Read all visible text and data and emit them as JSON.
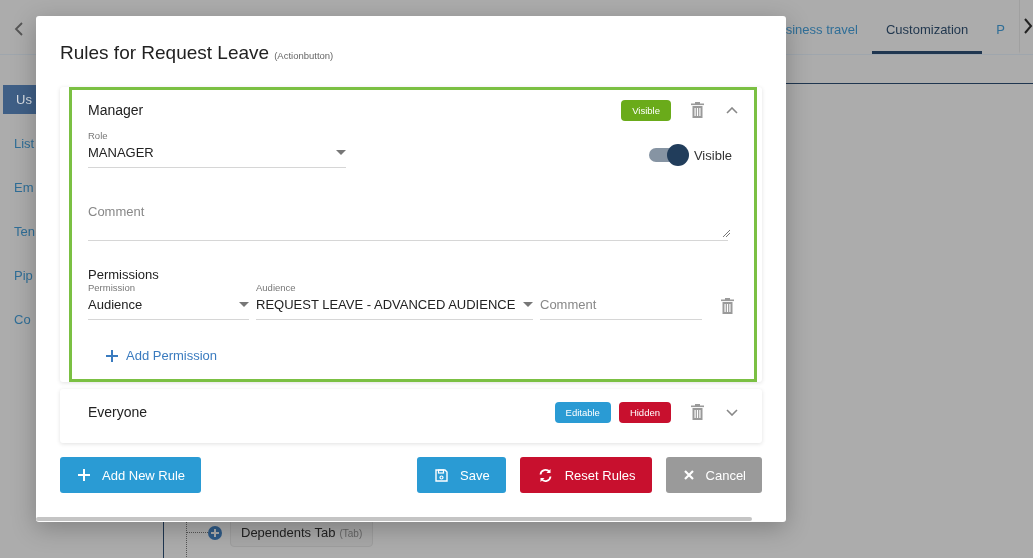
{
  "background_page": {
    "tabs": [
      {
        "label": "siness travel",
        "selected": false
      },
      {
        "label": "Customization",
        "selected": true
      },
      {
        "label": "P",
        "selected": false
      }
    ],
    "sidebar": {
      "items": [
        {
          "label": "Us",
          "selected": true
        },
        {
          "label": "List",
          "selected": false
        },
        {
          "label": "Em",
          "selected": false
        },
        {
          "label": "Ten",
          "selected": false
        },
        {
          "label": "Pip",
          "selected": false
        },
        {
          "label": "Co",
          "selected": false
        }
      ]
    },
    "tree": {
      "items": [
        {
          "label": "Dependents Tab",
          "tag": "(Tab)"
        }
      ]
    }
  },
  "dialog": {
    "title": "Rules for Request Leave",
    "subtitle": "(Actionbutton)",
    "rules": [
      {
        "name": "Manager",
        "expanded": true,
        "highlighted": true,
        "badges": [
          {
            "label": "Visible",
            "color": "#6aab1a"
          }
        ],
        "role": {
          "label": "Role",
          "value": "MANAGER"
        },
        "visibility_toggle": {
          "label": "Visible",
          "on": true
        },
        "comment": {
          "placeholder": "Comment"
        },
        "permissions": {
          "title": "Permissions",
          "add_label": "Add Permission",
          "rows": [
            {
              "permission": {
                "label": "Permission",
                "value": "Audience"
              },
              "audience": {
                "label": "Audience",
                "value": "REQUEST LEAVE - ADVANCED AUDIENCE"
              },
              "comment": {
                "placeholder": "Comment"
              }
            }
          ]
        }
      },
      {
        "name": "Everyone",
        "expanded": false,
        "highlighted": false,
        "badges": [
          {
            "label": "Editable",
            "color": "#2a9bd4"
          },
          {
            "label": "Hidden",
            "color": "#c8102e"
          }
        ]
      }
    ],
    "buttons": [
      {
        "label": "Add New Rule",
        "kind": "add"
      },
      {
        "label": "Save",
        "kind": "save"
      },
      {
        "label": "Reset Rules",
        "kind": "reset"
      },
      {
        "label": "Cancel",
        "kind": "cancel"
      }
    ]
  }
}
